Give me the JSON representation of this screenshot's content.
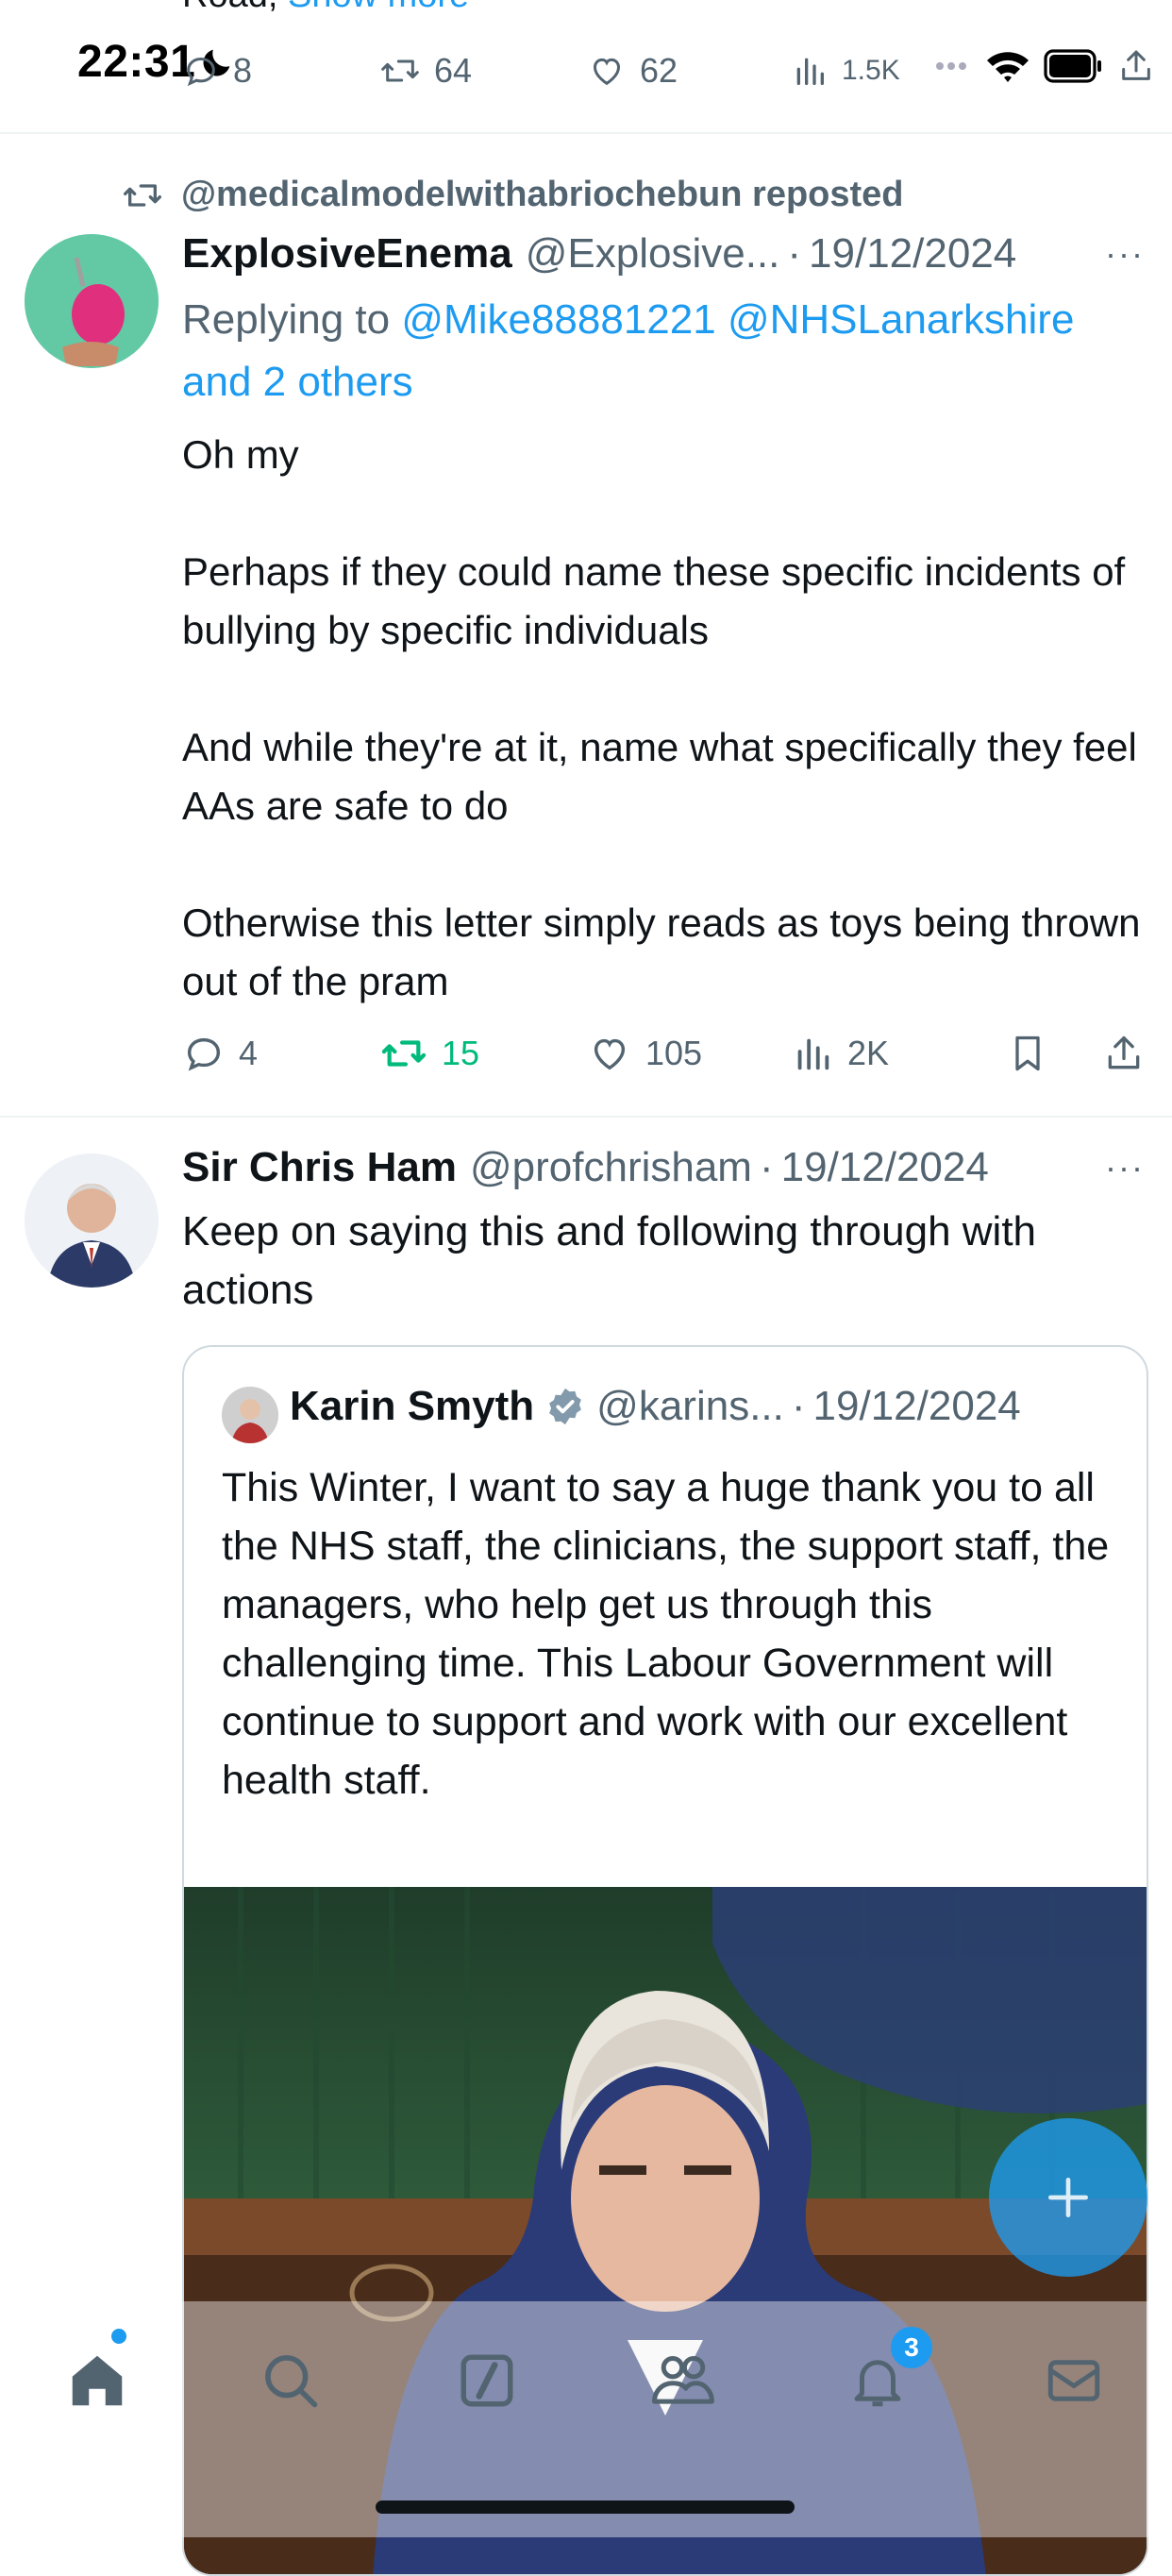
{
  "status_bar": {
    "time": "22:31"
  },
  "top_tweet": {
    "partial_text": "Road,",
    "show_more": "Show more",
    "replies": "8",
    "reposts": "64",
    "likes": "62",
    "views": "1.5K"
  },
  "tweet1": {
    "repost_label": "@medicalmodelwithabriochebun reposted",
    "author_name": "ExplosiveEnema",
    "author_handle": "@Explosive...",
    "date": "19/12/2024",
    "replying_prefix": "Replying to",
    "reply_targets": [
      "@Mike88881221",
      "@NHSLanarkshire"
    ],
    "reply_others": "and 2 others",
    "paragraphs": [
      "Oh my",
      "Perhaps if they could name these specific incidents of bullying by specific individuals",
      "And while they're at it, name what specifically they feel AAs are safe to do",
      "Otherwise this letter simply reads as toys being thrown out of the pram"
    ],
    "replies": "4",
    "reposts": "15",
    "likes": "105",
    "views": "2K"
  },
  "tweet2": {
    "author_name": "Sir Chris Ham",
    "author_handle": "@profchrisham",
    "date": "19/12/2024",
    "text": "Keep on saying this and following through with actions",
    "quote": {
      "author_name": "Karin Smyth",
      "author_handle": "@karins...",
      "date": "19/12/2024",
      "text": "This Winter, I want to say a huge thank you to all the NHS staff, the clinicians, the support staff, the managers, who help get us through this challenging time. This Labour Government will continue to support and work with our excellent health staff."
    }
  },
  "bottom_nav": {
    "notifications_badge": "3"
  },
  "colors": {
    "accent": "#1d9bf0",
    "repost_active": "#00ba7c",
    "muted": "#536471",
    "text": "#0f1419"
  }
}
